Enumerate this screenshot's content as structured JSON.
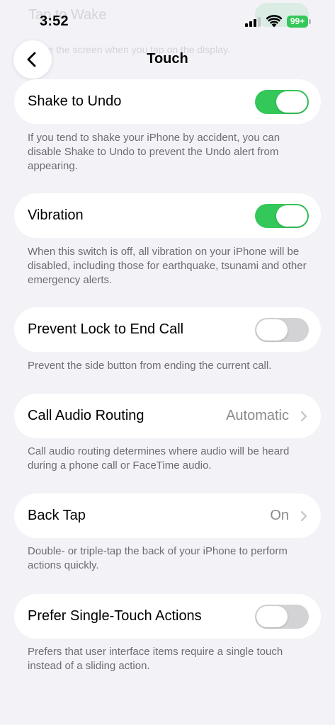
{
  "status_bar": {
    "time": "3:52",
    "battery": "99+"
  },
  "background": {
    "title": "Tap to Wake",
    "description": "Wake the screen when you tap on the display."
  },
  "header": {
    "title": "Touch",
    "back_icon": "chevron-left-icon"
  },
  "settings": [
    {
      "label": "Shake to Undo",
      "control": "toggle",
      "on": true,
      "footer": "If you tend to shake your iPhone by accident, you can disable Shake to Undo to prevent the Undo alert from appearing."
    },
    {
      "label": "Vibration",
      "control": "toggle",
      "on": true,
      "footer": "When this switch is off, all vibration on your iPhone will be disabled, including those for earthquake, tsunami and other emergency alerts."
    },
    {
      "label": "Prevent Lock to End Call",
      "control": "toggle",
      "on": false,
      "footer": "Prevent the side button from ending the current call."
    },
    {
      "label": "Call Audio Routing",
      "control": "disclosure",
      "value": "Automatic",
      "footer": "Call audio routing determines where audio will be heard during a phone call or FaceTime audio."
    },
    {
      "label": "Back Tap",
      "control": "disclosure",
      "value": "On",
      "footer": "Double- or triple-tap the back of your iPhone to perform actions quickly."
    },
    {
      "label": "Prefer Single-Touch Actions",
      "control": "toggle",
      "on": false,
      "footer": "Prefers that user interface items require a single touch instead of a sliding action."
    }
  ],
  "colors": {
    "background": "#f2f2f7",
    "card": "#ffffff",
    "toggle_on": "#34c759",
    "toggle_off": "#d3d3d6",
    "secondary_text": "#6d6d72",
    "value_text": "#8a8a8e"
  }
}
